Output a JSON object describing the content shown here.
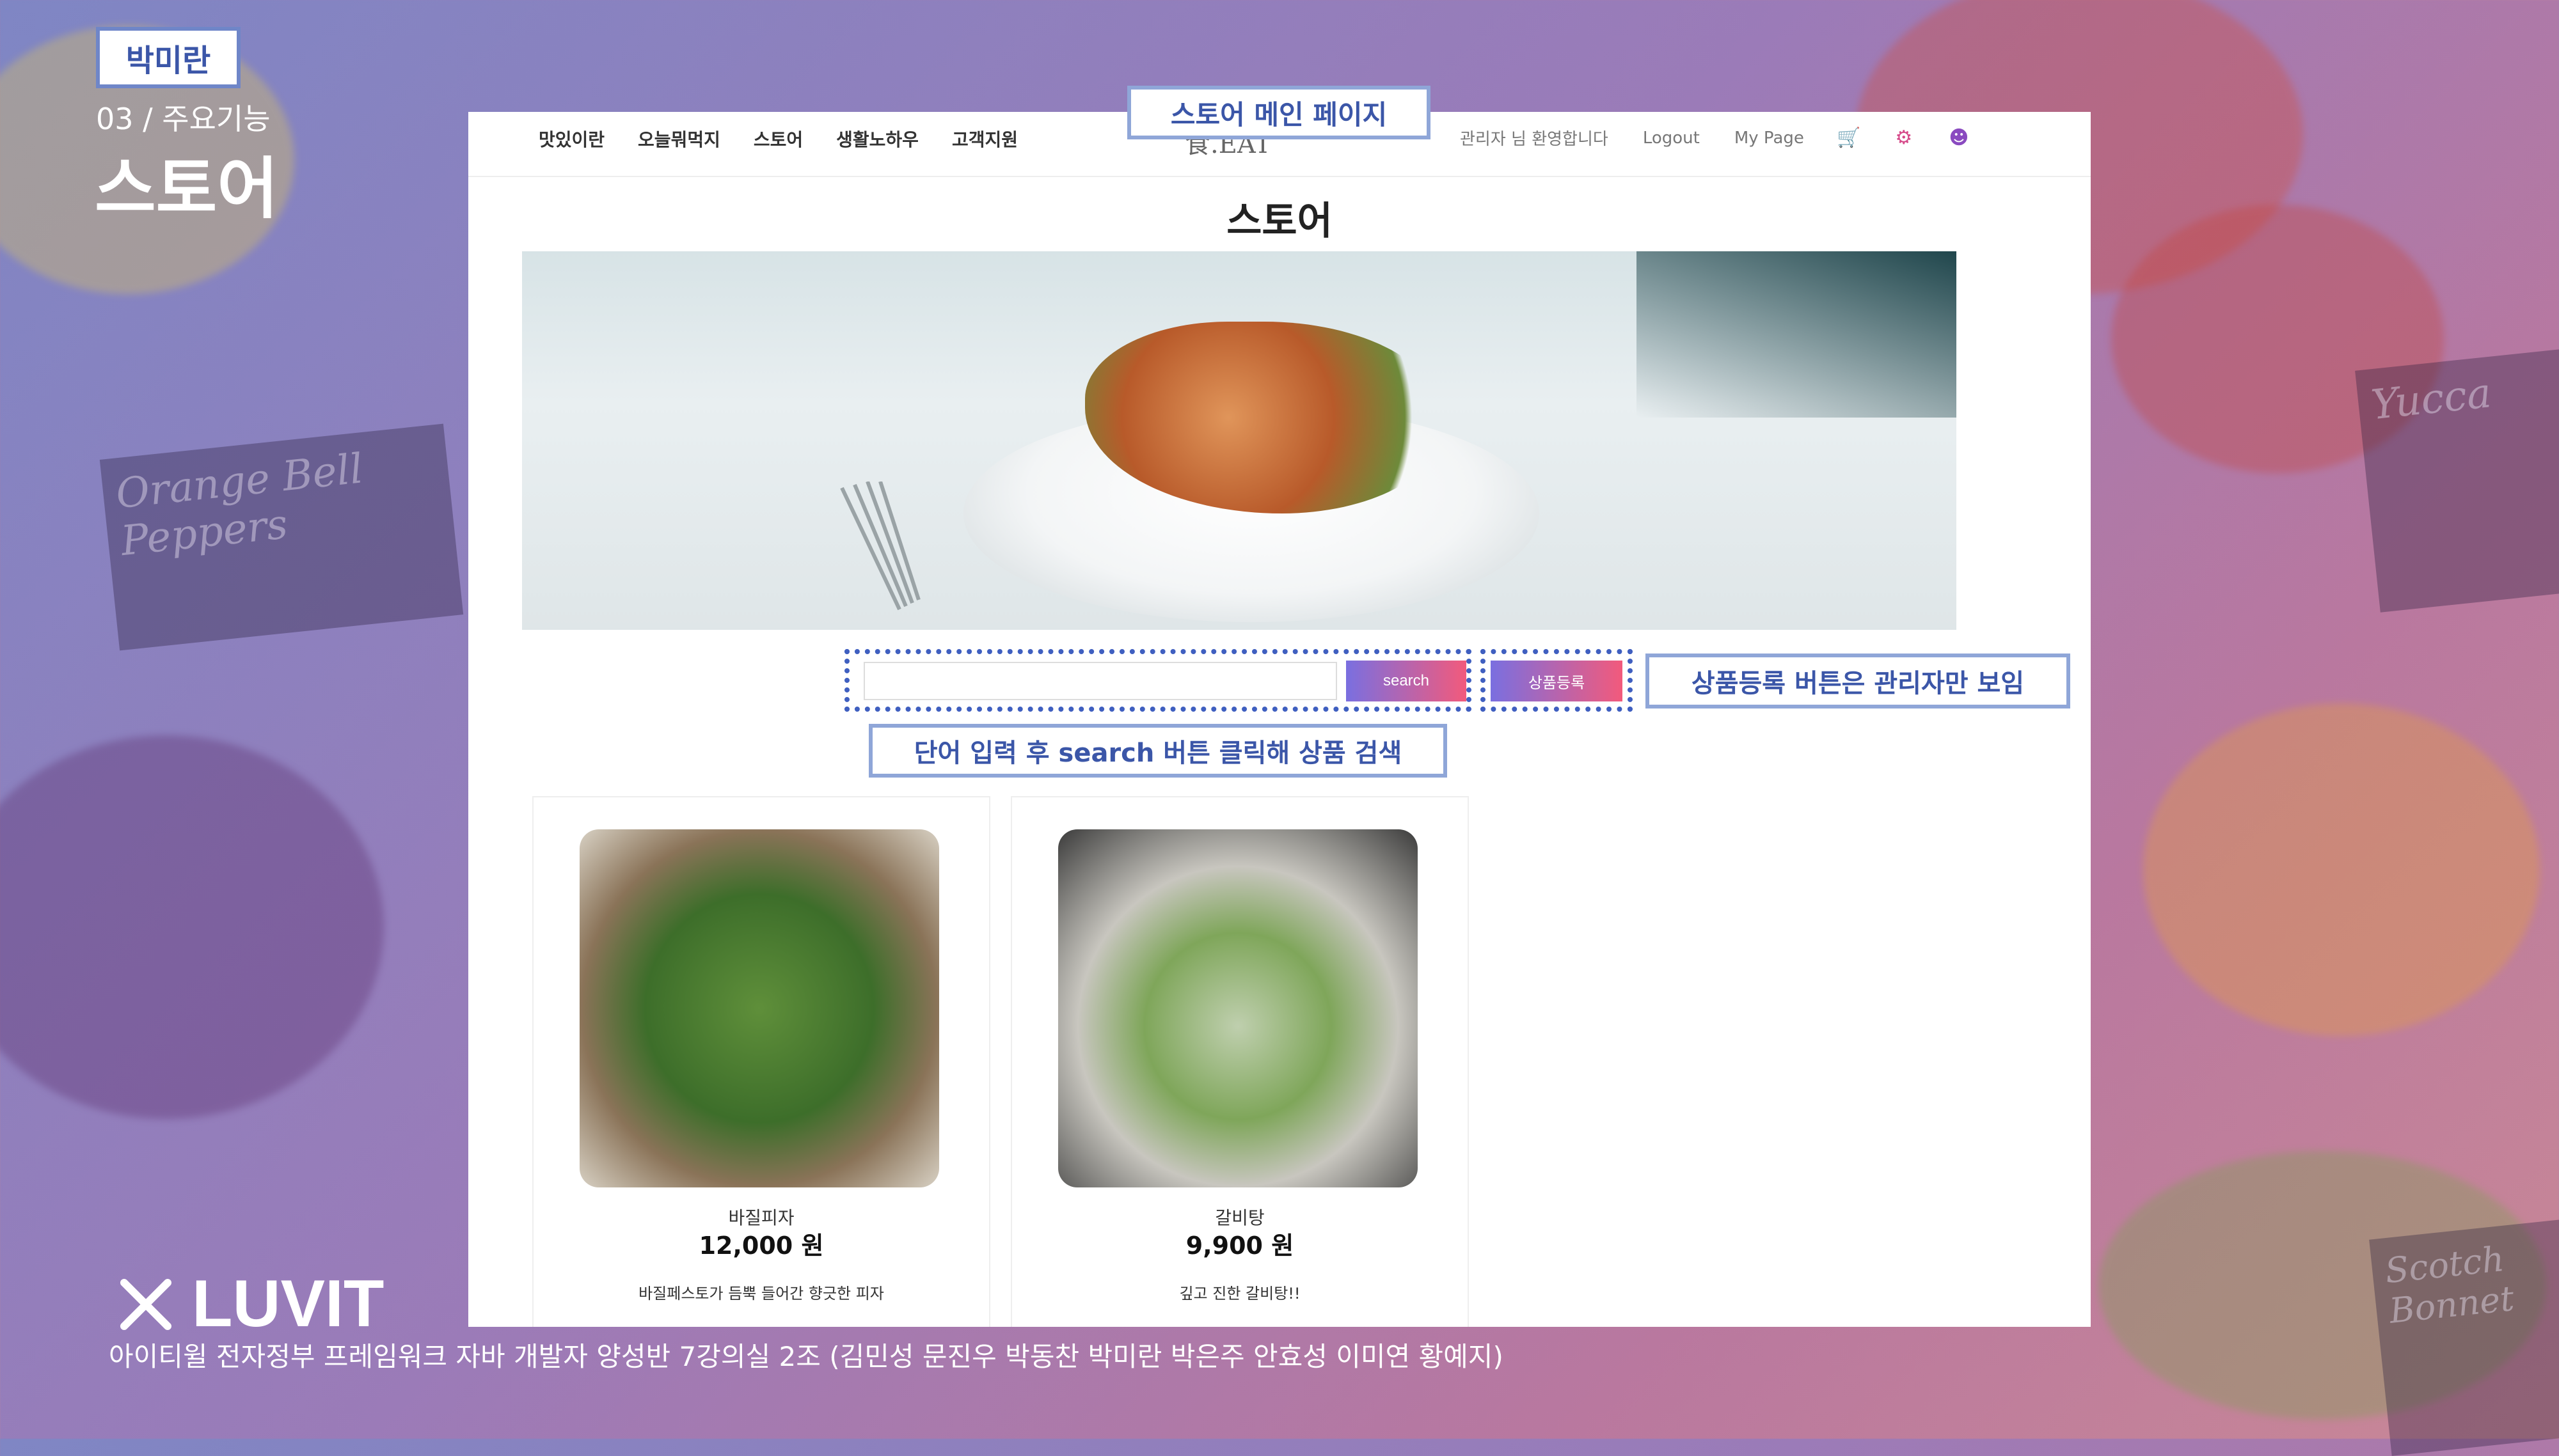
{
  "slide": {
    "presenter_badge": "박미란",
    "section_number": "03 / 주요기능",
    "section_title": "스토어",
    "brand_name": "LUVIT",
    "footer_text": "아이티윌 전자정부 프레임워크 자바 개발자 양성반 7강의실 2조 (김민성 문진우 박동찬 박미란 박은주 안효성 이미연 황예지)"
  },
  "callouts": {
    "main_page": "스토어 메인 페이지",
    "admin_only": "상품등록 버튼은 관리자만 보임",
    "search_hint": "단어 입력 후 search 버튼 클릭해 상품 검색"
  },
  "site": {
    "nav": [
      "맛있이란",
      "오늘뭐먹지",
      "스토어",
      "생활노하우",
      "고객지원"
    ],
    "logo": "食.EAT",
    "greeting": "관리자 님 환영합니다",
    "logout": "Logout",
    "mypage": "My Page",
    "page_title": "스토어",
    "search_placeholder": "",
    "search_button": "search",
    "register_button": "상품등록"
  },
  "products": [
    {
      "name": "바질피자",
      "price": "12,000 원",
      "desc": "바질페스토가 듬뿍 들어간 향긋한 피자"
    },
    {
      "name": "갈비탕",
      "price": "9,900 원",
      "desc": "깊고 진한 갈비탕!!"
    }
  ],
  "colors": {
    "accent_blue": "#3f5fc0",
    "button_gradient_start": "#7a6fe0",
    "button_gradient_end": "#f25a7c"
  },
  "icons": [
    "cart-icon",
    "fork-knife-icon",
    "user-admin-icon",
    "luvit-logo-icon"
  ]
}
